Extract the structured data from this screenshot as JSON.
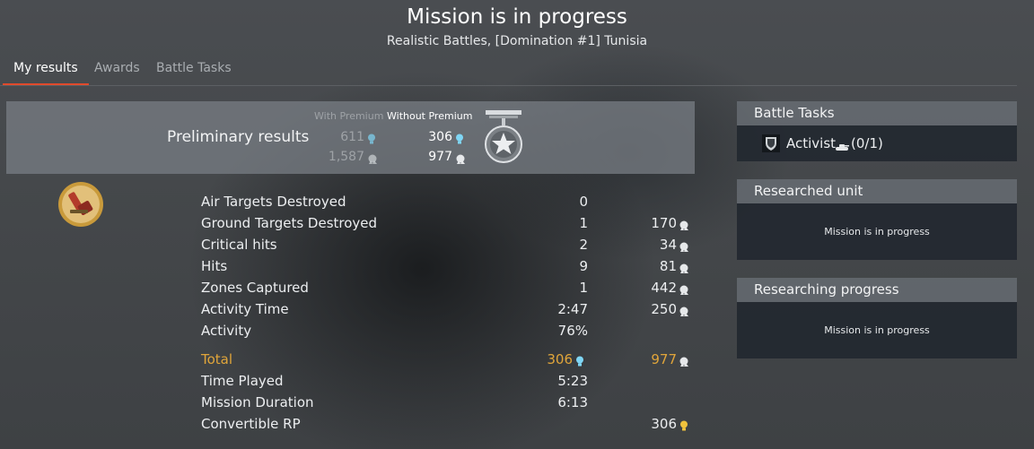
{
  "header": {
    "title": "Mission is in progress",
    "subtitle": "Realistic Battles, [Domination #1] Tunisia"
  },
  "tabs": [
    {
      "label": "My results",
      "active": true
    },
    {
      "label": "Awards",
      "active": false
    },
    {
      "label": "Battle Tasks",
      "active": false
    }
  ],
  "preliminary": {
    "label": "Preliminary results",
    "with_premium_label": "With Premium",
    "without_premium_label": "Without Premium",
    "with_premium_rp": "611",
    "with_premium_sl": "1,587",
    "without_premium_rp": "306",
    "without_premium_sl": "977"
  },
  "stats": [
    {
      "label": "Air Targets Destroyed",
      "count": "0",
      "reward": ""
    },
    {
      "label": "Ground Targets Destroyed",
      "count": "1",
      "reward": "170"
    },
    {
      "label": "Critical hits",
      "count": "2",
      "reward": "34"
    },
    {
      "label": "Hits",
      "count": "9",
      "reward": "81"
    },
    {
      "label": "Zones Captured",
      "count": "1",
      "reward": "442"
    },
    {
      "label": "Activity Time",
      "count": "2:47",
      "reward": "250"
    },
    {
      "label": "Activity",
      "count": "76%",
      "reward": ""
    }
  ],
  "total": {
    "label": "Total",
    "rp": "306",
    "sl": "977"
  },
  "extra": [
    {
      "label": "Time Played",
      "value": "5:23"
    },
    {
      "label": "Mission Duration",
      "value": "6:13"
    },
    {
      "label": "Convertible RP",
      "value": "306"
    }
  ],
  "right": {
    "battle_tasks_title": "Battle Tasks",
    "task_name": "Activist",
    "task_progress": "(0/1)",
    "researched_unit_title": "Researched unit",
    "researched_unit_text": "Mission is in progress",
    "researching_progress_title": "Researching progress",
    "researching_progress_text": "Mission is in progress"
  },
  "colors": {
    "accent_tab": "#e04a2c",
    "total_gold": "#e0a53a",
    "rp_icon": "#7fd6f5",
    "sl_icon": "#d8dcdf",
    "convertible_icon": "#f0c23c"
  }
}
